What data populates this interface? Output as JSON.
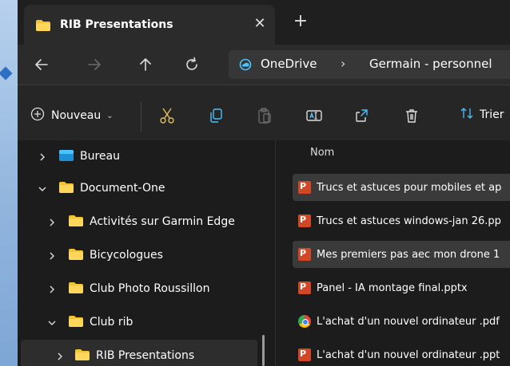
{
  "tab": {
    "title": "RIB Presentations",
    "close_glyph": "✕",
    "new_glyph": "+"
  },
  "address": {
    "root": "OneDrive",
    "sep": "›",
    "segment": "Germain - personnel"
  },
  "toolbar": {
    "new_label": "Nouveau",
    "new_chevron": "⌄",
    "sort_label": "Trier"
  },
  "sidebar": {
    "items": [
      {
        "label": "Bureau",
        "expand": "collapsed",
        "indent": 0,
        "icon": "desktop-folder-icon"
      },
      {
        "label": "Document-One",
        "expand": "expanded",
        "indent": 0,
        "icon": "folder-icon"
      },
      {
        "label": "Activités sur Garmin Edge",
        "expand": "collapsed",
        "indent": 1,
        "icon": "folder-icon"
      },
      {
        "label": "Bicycologues",
        "expand": "collapsed",
        "indent": 1,
        "icon": "folder-icon"
      },
      {
        "label": "Club Photo Roussillon",
        "expand": "collapsed",
        "indent": 1,
        "icon": "folder-icon"
      },
      {
        "label": "Club rib",
        "expand": "expanded",
        "indent": 1,
        "icon": "folder-icon"
      },
      {
        "label": "RIB Presentations",
        "expand": "collapsed",
        "indent": 2,
        "icon": "folder-icon",
        "selected": true
      }
    ]
  },
  "content": {
    "column_header": "Nom",
    "files": [
      {
        "name": "Trucs et astuces pour mobiles et ap",
        "type": "pptx",
        "highlighted": true
      },
      {
        "name": "Trucs et astuces windows-jan 26.pp",
        "type": "pptx",
        "highlighted": false
      },
      {
        "name": "Mes premiers pas aec mon drone 1",
        "type": "pptx",
        "highlighted": true
      },
      {
        "name": "Panel - IA  montage final.pptx",
        "type": "pptx",
        "highlighted": false
      },
      {
        "name": "L'achat d'un nouvel ordinateur .pdf",
        "type": "pdf",
        "highlighted": false
      },
      {
        "name": "L'achat d'un nouvel ordinateur .ppt",
        "type": "pptx",
        "highlighted": false
      }
    ]
  },
  "colors": {
    "folder": "#f4c430",
    "accent": "#4cc2ff",
    "ppt": "#d24726"
  }
}
